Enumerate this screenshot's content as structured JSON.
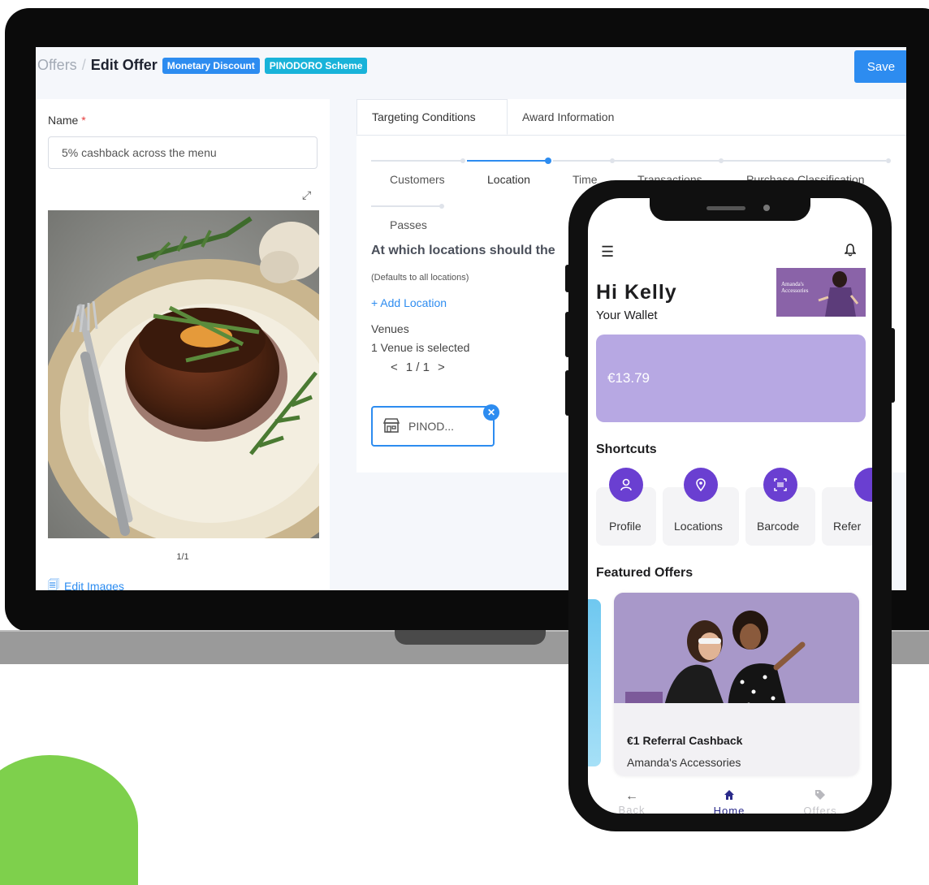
{
  "breadcrumb": {
    "root": "Offers",
    "separator": "/",
    "current": "Edit Offer"
  },
  "badges": [
    "Monetary Discount",
    "PINODORO Scheme"
  ],
  "toolbar": {
    "save_label": "Save"
  },
  "offer_form": {
    "name_label": "Name",
    "required_mark": "*",
    "name_value": "5% cashback across the menu",
    "image_pager": "1/1",
    "edit_images_label": "Edit Images"
  },
  "tabs": [
    {
      "label": "Targeting Conditions",
      "active": true
    },
    {
      "label": "Award Information",
      "active": false
    }
  ],
  "steps": [
    {
      "label": "Customers",
      "active": false
    },
    {
      "label": "Location",
      "active": true
    },
    {
      "label": "Time",
      "active": false
    },
    {
      "label": "Transactions",
      "active": false
    },
    {
      "label": "Purchase Classification",
      "active": false
    },
    {
      "label": "Passes",
      "active": false
    }
  ],
  "location_section": {
    "question": "At which locations should the",
    "hint": "(Defaults to all locations)",
    "add_location": "+ Add Location",
    "venues_label": "Venues",
    "venues_selected": "1 Venue is selected",
    "pager_prev": "<",
    "pager_text": "1 / 1",
    "pager_next": ">",
    "venue_chip": "PINOD..."
  },
  "phone": {
    "greeting": "Hi Kelly",
    "wallet_label": "Your Wallet",
    "brand_banner_text": "Amanda's Accessories",
    "balance": "€13.79",
    "shortcuts_title": "Shortcuts",
    "shortcuts": [
      {
        "label": "Profile",
        "icon": "person-icon"
      },
      {
        "label": "Locations",
        "icon": "location-pin-icon"
      },
      {
        "label": "Barcode",
        "icon": "barcode-icon"
      },
      {
        "label": "Refer",
        "icon": "refer-icon"
      }
    ],
    "featured_title": "Featured Offers",
    "featured_offer": {
      "title": "€1 Referral Cashback",
      "merchant": "Amanda's Accessories"
    },
    "nav": [
      {
        "label": "Back",
        "icon": "arrow-left-icon",
        "active": false
      },
      {
        "label": "Home",
        "icon": "home-icon",
        "active": true
      },
      {
        "label": "Offers",
        "icon": "tag-icon",
        "active": false
      }
    ]
  },
  "colors": {
    "primary": "#2d8cf0",
    "cyan_badge": "#19b3d9",
    "wallet_card": "#b7a8e3",
    "shortcut_circle": "#6a3fd1",
    "nav_active": "#2a2a8a"
  }
}
